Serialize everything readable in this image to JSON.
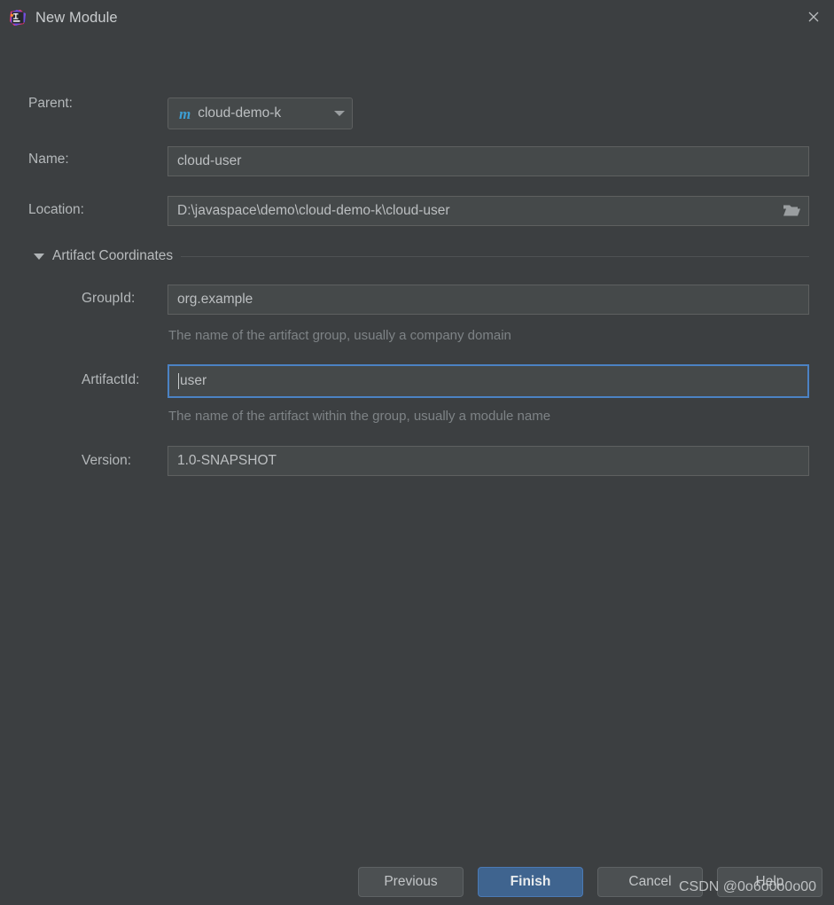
{
  "window": {
    "title": "New Module",
    "app_icon": "intellij-idea-icon",
    "close_icon": "close-icon",
    "background_color": "#3c3f41",
    "accent_color": "#3f648f",
    "focus_border_color": "#4b82c4"
  },
  "form": {
    "parent": {
      "label": "Parent:",
      "value": "cloud-demo-k",
      "icon": "maven-icon",
      "icon_glyph": "m",
      "icon_color": "#3d9fd4",
      "dropdown_icon": "chevron-down-icon"
    },
    "name": {
      "label": "Name:",
      "value": "cloud-user"
    },
    "location": {
      "label": "Location:",
      "value": "D:\\javaspace\\demo\\cloud-demo-k\\cloud-user",
      "browse_icon": "folder-icon"
    },
    "artifact_section": {
      "title": "Artifact Coordinates",
      "expanded": true,
      "collapse_icon": "triangle-down-icon"
    },
    "group_id": {
      "label": "GroupId:",
      "value": "org.example",
      "hint": "The name of the artifact group, usually a company domain"
    },
    "artifact_id": {
      "label": "ArtifactId:",
      "value": "user",
      "hint": "The name of the artifact within the group, usually a module name",
      "focused": true
    },
    "version": {
      "label": "Version:",
      "value": "1.0-SNAPSHOT"
    }
  },
  "buttons": {
    "previous": "Previous",
    "finish": "Finish",
    "cancel": "Cancel",
    "help": "Help"
  },
  "watermark": {
    "text": "CSDN @0o6o0o0o00"
  }
}
